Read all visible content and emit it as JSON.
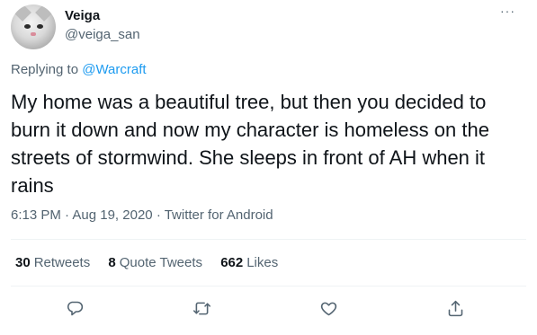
{
  "author": {
    "display_name": "Veiga",
    "handle": "@veiga_san"
  },
  "reply_to": {
    "prefix": "Replying to",
    "mention": "@Warcraft"
  },
  "tweet": {
    "text": "My home was a beautiful tree, but then you decided to burn it down and now my character is homeless on the streets of stormwind. She sleeps in front of AH when it rains"
  },
  "meta": {
    "time": "6:13 PM",
    "sep1": "·",
    "date": "Aug 19, 2020",
    "sep2": "·",
    "source": "Twitter for Android"
  },
  "stats": {
    "retweets": {
      "count": "30",
      "label": "Retweets"
    },
    "quotes": {
      "count": "8",
      "label": "Quote Tweets"
    },
    "likes": {
      "count": "662",
      "label": "Likes"
    }
  },
  "more_label": "···",
  "icons": {
    "reply": "reply-icon",
    "retweet": "retweet-icon",
    "like": "heart-icon",
    "share": "share-icon"
  },
  "colors": {
    "link": "#1d9bf0",
    "secondary": "#536471",
    "primary": "#0f1419"
  }
}
